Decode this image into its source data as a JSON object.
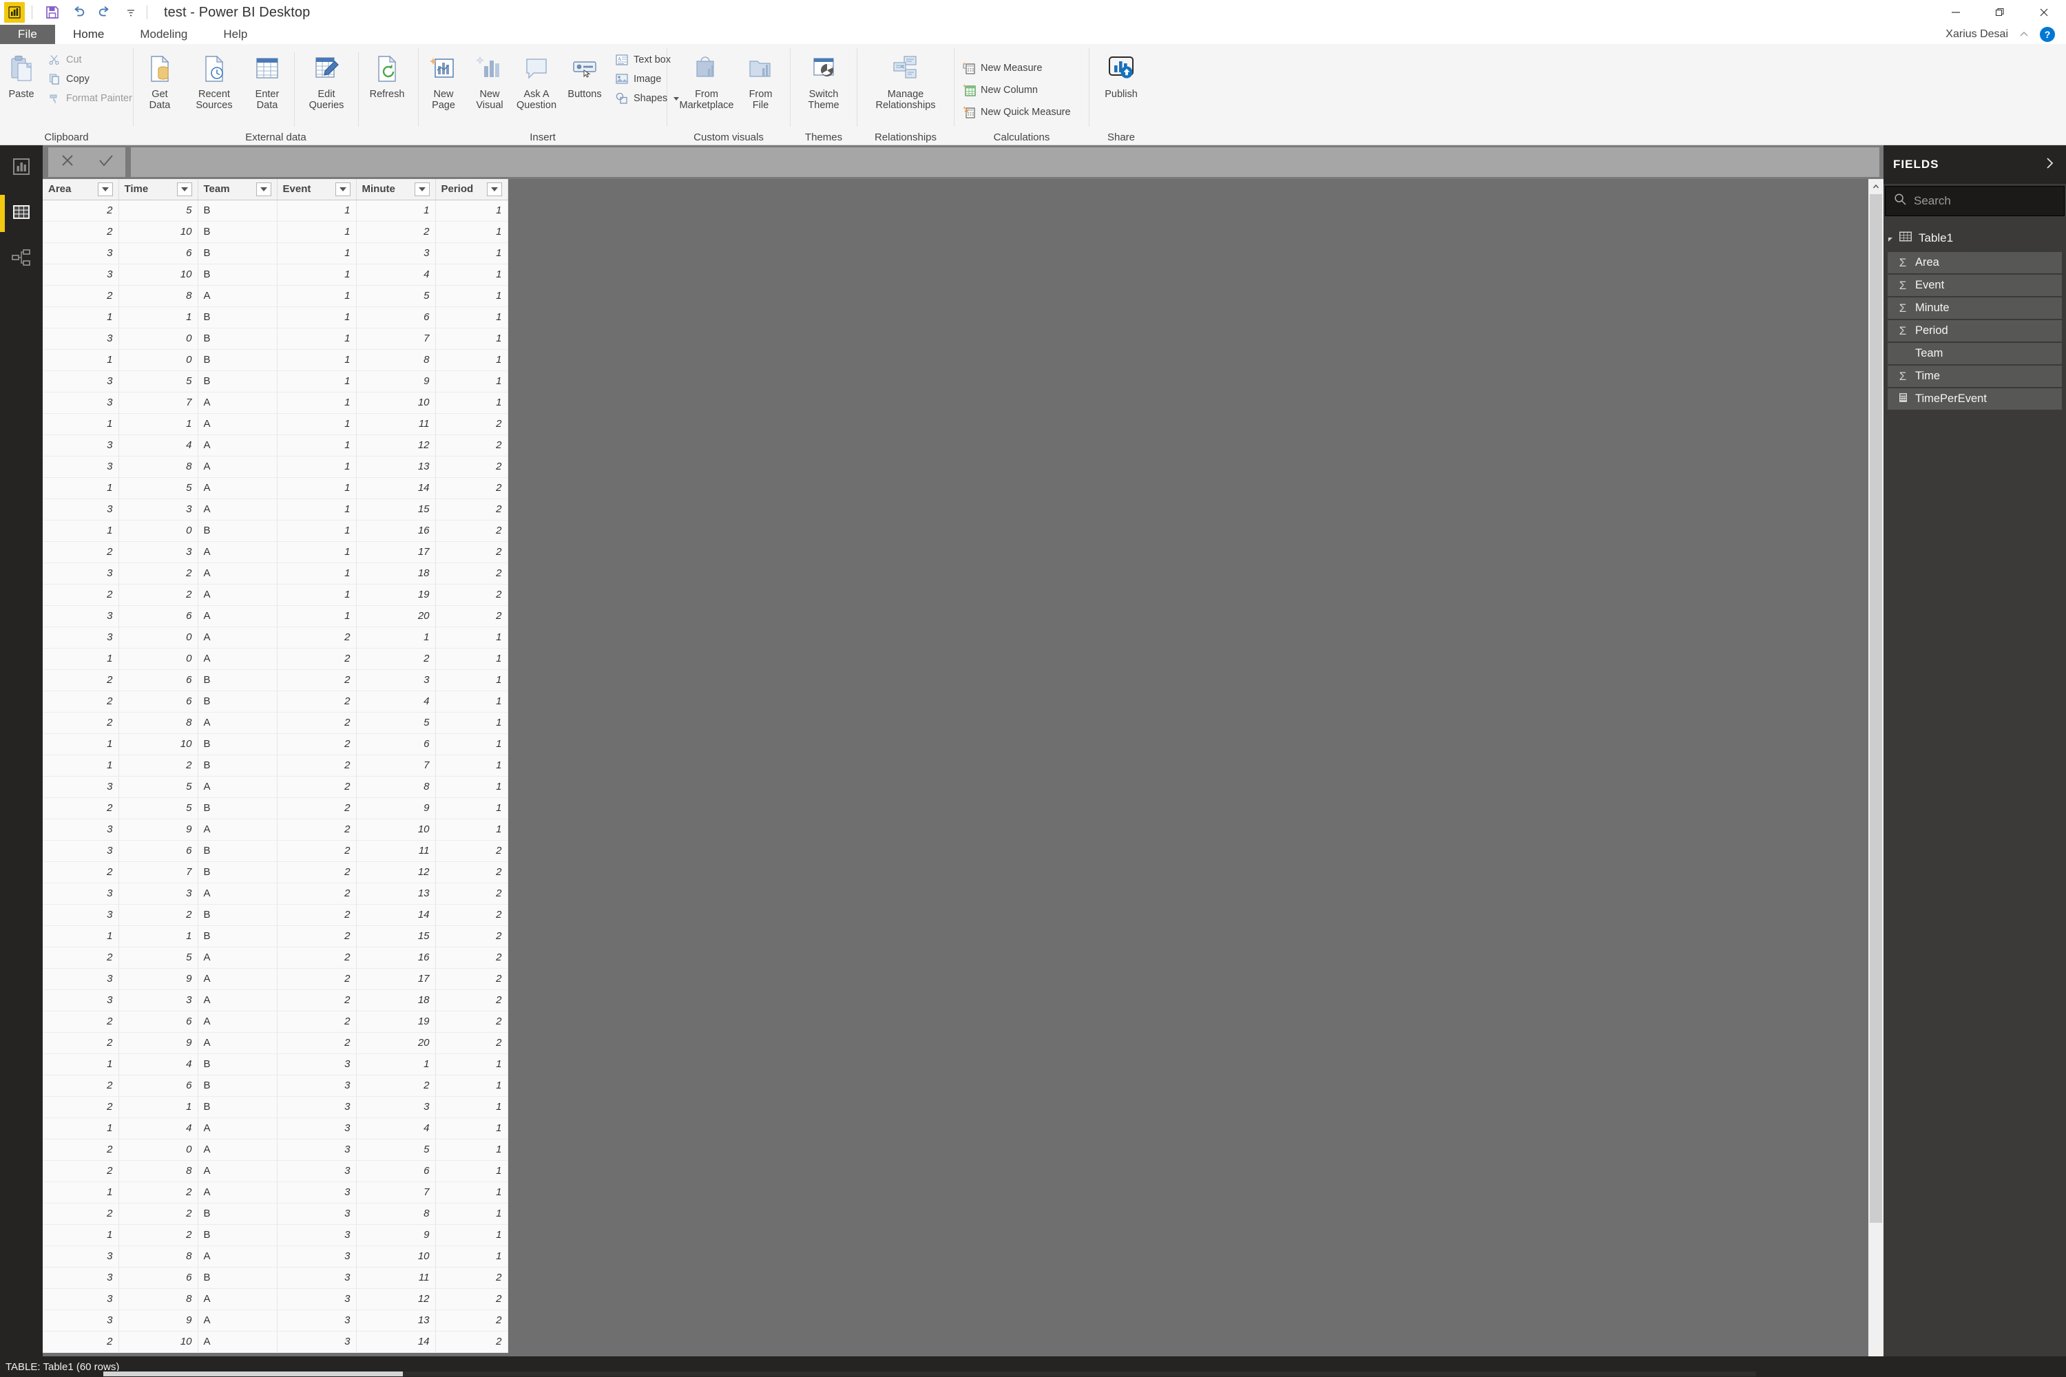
{
  "window": {
    "title": "test - Power BI Desktop",
    "app_icon": "power-bi-logo",
    "minimize": "—",
    "restore": "❐",
    "close": "✕"
  },
  "quick_access": {
    "save": "save-icon",
    "undo": "undo-icon",
    "redo": "redo-icon",
    "customize": "customize-qat-icon"
  },
  "tabs": {
    "file": "File",
    "items": [
      {
        "label": "Home",
        "active": true
      },
      {
        "label": "Modeling",
        "active": false
      },
      {
        "label": "Help",
        "active": false
      }
    ]
  },
  "account": {
    "user": "Xarius Desai",
    "collapse_ribbon": "chevron-up-icon",
    "help": "?"
  },
  "ribbon": {
    "groups": [
      {
        "name": "Clipboard",
        "label": "Clipboard",
        "big": [
          {
            "id": "paste",
            "label": "Paste"
          }
        ],
        "small": [
          {
            "id": "cut",
            "label": "Cut",
            "dim": true
          },
          {
            "id": "copy",
            "label": "Copy",
            "dim": false
          },
          {
            "id": "format-painter",
            "label": "Format Painter",
            "dim": true
          }
        ]
      },
      {
        "name": "External data",
        "label": "External data",
        "big": [
          {
            "id": "get-data",
            "label": "Get\nData",
            "caret": true
          },
          {
            "id": "recent-sources",
            "label": "Recent\nSources",
            "caret": true
          },
          {
            "id": "enter-data",
            "label": "Enter\nData",
            "caret": false
          },
          {
            "id": "edit-queries",
            "label": "Edit\nQueries",
            "caret": true
          },
          {
            "id": "refresh",
            "label": "Refresh",
            "caret": false
          }
        ]
      },
      {
        "name": "Insert",
        "label": "Insert",
        "big": [
          {
            "id": "new-page",
            "label": "New\nPage",
            "caret": true
          },
          {
            "id": "new-visual",
            "label": "New\nVisual",
            "caret": false
          },
          {
            "id": "ask-a-question",
            "label": "Ask A\nQuestion",
            "caret": false
          },
          {
            "id": "buttons",
            "label": "Buttons",
            "caret": true
          }
        ],
        "small": [
          {
            "id": "text-box",
            "label": "Text box"
          },
          {
            "id": "image",
            "label": "Image"
          },
          {
            "id": "shapes",
            "label": "Shapes",
            "caret": true
          }
        ]
      },
      {
        "name": "Custom visuals",
        "label": "Custom visuals",
        "big": [
          {
            "id": "from-marketplace",
            "label": "From\nMarketplace",
            "caret": false
          },
          {
            "id": "from-file",
            "label": "From\nFile",
            "caret": false
          }
        ]
      },
      {
        "name": "Themes",
        "label": "Themes",
        "big": [
          {
            "id": "switch-theme",
            "label": "Switch\nTheme",
            "caret": true
          }
        ]
      },
      {
        "name": "Relationships",
        "label": "Relationships",
        "big": [
          {
            "id": "manage-relationships",
            "label": "Manage\nRelationships",
            "caret": false
          }
        ]
      },
      {
        "name": "Calculations",
        "label": "Calculations",
        "small": [
          {
            "id": "new-measure",
            "label": "New Measure"
          },
          {
            "id": "new-column",
            "label": "New Column"
          },
          {
            "id": "new-quick-measure",
            "label": "New Quick Measure"
          }
        ]
      },
      {
        "name": "Share",
        "label": "Share",
        "big": [
          {
            "id": "publish",
            "label": "Publish",
            "caret": false
          }
        ]
      }
    ]
  },
  "view_rail": {
    "items": [
      {
        "id": "report-view",
        "icon": "report-chart-icon",
        "active": false
      },
      {
        "id": "data-view",
        "icon": "data-table-icon",
        "active": true
      },
      {
        "id": "model-view",
        "icon": "model-relationship-icon",
        "active": false
      }
    ]
  },
  "formula_bar": {
    "cancel": "cancel-icon",
    "accept": "accept-icon",
    "value": ""
  },
  "table": {
    "name": "Table1",
    "columns": [
      "Area",
      "Time",
      "Team",
      "Event",
      "Minute",
      "Period"
    ],
    "rows": [
      [
        2,
        5,
        "B",
        1,
        1,
        1
      ],
      [
        2,
        10,
        "B",
        1,
        2,
        1
      ],
      [
        3,
        6,
        "B",
        1,
        3,
        1
      ],
      [
        3,
        10,
        "B",
        1,
        4,
        1
      ],
      [
        2,
        8,
        "A",
        1,
        5,
        1
      ],
      [
        1,
        1,
        "B",
        1,
        6,
        1
      ],
      [
        3,
        0,
        "B",
        1,
        7,
        1
      ],
      [
        1,
        0,
        "B",
        1,
        8,
        1
      ],
      [
        3,
        5,
        "B",
        1,
        9,
        1
      ],
      [
        3,
        7,
        "A",
        1,
        10,
        1
      ],
      [
        1,
        1,
        "A",
        1,
        11,
        2
      ],
      [
        3,
        4,
        "A",
        1,
        12,
        2
      ],
      [
        3,
        8,
        "A",
        1,
        13,
        2
      ],
      [
        1,
        5,
        "A",
        1,
        14,
        2
      ],
      [
        3,
        3,
        "A",
        1,
        15,
        2
      ],
      [
        1,
        0,
        "B",
        1,
        16,
        2
      ],
      [
        2,
        3,
        "A",
        1,
        17,
        2
      ],
      [
        3,
        2,
        "A",
        1,
        18,
        2
      ],
      [
        2,
        2,
        "A",
        1,
        19,
        2
      ],
      [
        3,
        6,
        "A",
        1,
        20,
        2
      ],
      [
        3,
        0,
        "A",
        2,
        1,
        1
      ],
      [
        1,
        0,
        "A",
        2,
        2,
        1
      ],
      [
        2,
        6,
        "B",
        2,
        3,
        1
      ],
      [
        2,
        6,
        "B",
        2,
        4,
        1
      ],
      [
        2,
        8,
        "A",
        2,
        5,
        1
      ],
      [
        1,
        10,
        "B",
        2,
        6,
        1
      ],
      [
        1,
        2,
        "B",
        2,
        7,
        1
      ],
      [
        3,
        5,
        "A",
        2,
        8,
        1
      ],
      [
        2,
        5,
        "B",
        2,
        9,
        1
      ],
      [
        3,
        9,
        "A",
        2,
        10,
        1
      ],
      [
        3,
        6,
        "B",
        2,
        11,
        2
      ],
      [
        2,
        7,
        "B",
        2,
        12,
        2
      ],
      [
        3,
        3,
        "A",
        2,
        13,
        2
      ],
      [
        3,
        2,
        "B",
        2,
        14,
        2
      ],
      [
        1,
        1,
        "B",
        2,
        15,
        2
      ],
      [
        2,
        5,
        "A",
        2,
        16,
        2
      ],
      [
        3,
        9,
        "A",
        2,
        17,
        2
      ],
      [
        3,
        3,
        "A",
        2,
        18,
        2
      ],
      [
        2,
        6,
        "A",
        2,
        19,
        2
      ],
      [
        2,
        9,
        "A",
        2,
        20,
        2
      ],
      [
        1,
        4,
        "B",
        3,
        1,
        1
      ],
      [
        2,
        6,
        "B",
        3,
        2,
        1
      ],
      [
        2,
        1,
        "B",
        3,
        3,
        1
      ],
      [
        1,
        4,
        "A",
        3,
        4,
        1
      ],
      [
        2,
        0,
        "A",
        3,
        5,
        1
      ],
      [
        2,
        8,
        "A",
        3,
        6,
        1
      ],
      [
        1,
        2,
        "A",
        3,
        7,
        1
      ],
      [
        2,
        2,
        "B",
        3,
        8,
        1
      ],
      [
        1,
        2,
        "B",
        3,
        9,
        1
      ],
      [
        3,
        8,
        "A",
        3,
        10,
        1
      ],
      [
        3,
        6,
        "B",
        3,
        11,
        2
      ],
      [
        3,
        8,
        "A",
        3,
        12,
        2
      ],
      [
        3,
        9,
        "A",
        3,
        13,
        2
      ],
      [
        2,
        10,
        "A",
        3,
        14,
        2
      ]
    ]
  },
  "fields_pane": {
    "title": "FIELDS",
    "expand_icon": "chevron-right-icon",
    "search_placeholder": "Search",
    "table_name": "Table1",
    "items": [
      {
        "label": "Area",
        "kind": "sum"
      },
      {
        "label": "Event",
        "kind": "sum"
      },
      {
        "label": "Minute",
        "kind": "sum"
      },
      {
        "label": "Period",
        "kind": "sum"
      },
      {
        "label": "Team",
        "kind": "text"
      },
      {
        "label": "Time",
        "kind": "sum"
      },
      {
        "label": "TimePerEvent",
        "kind": "measure"
      }
    ],
    "sum_glyph": "Σ"
  },
  "status_bar": {
    "text": "TABLE: Table1 (60 rows)"
  },
  "colors": {
    "accent": "#F2C811",
    "dark_chrome": "#252423",
    "fields_bg": "#3b3a39",
    "ribbon_bg": "#f5f5f5",
    "canvas_bg": "#6f6f6f",
    "file_tab": "#666666",
    "help_blue": "#0078D4"
  }
}
